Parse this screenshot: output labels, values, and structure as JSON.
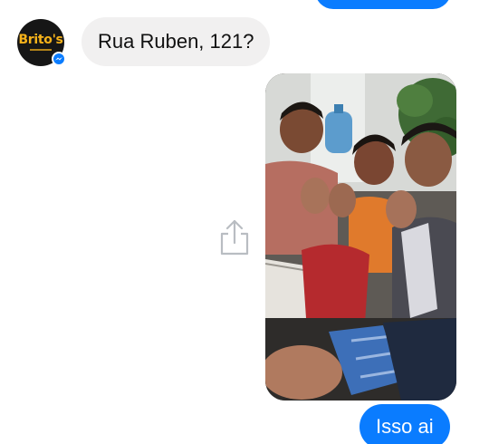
{
  "contact": {
    "avatar_text": "Brito's",
    "avatar_icon": "brand-logo-icon",
    "badge_icon": "messenger-icon"
  },
  "messages": [
    {
      "direction": "incoming",
      "text": "Rua Ruben, 121?"
    },
    {
      "direction": "outgoing",
      "type": "photo",
      "share_icon": "share-icon"
    },
    {
      "direction": "outgoing",
      "text": "Isso ai"
    }
  ],
  "colors": {
    "outgoing_bubble": "#0a7cff",
    "incoming_bubble": "#f1f0f0",
    "background": "#ffffff"
  }
}
